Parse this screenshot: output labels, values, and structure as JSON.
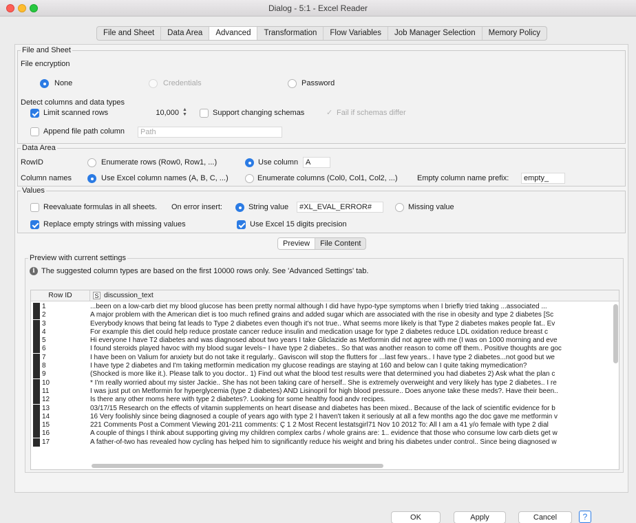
{
  "window": {
    "title": "Dialog - 5:1 - Excel Reader"
  },
  "tabs": [
    "File and Sheet",
    "Data Area",
    "Advanced",
    "Transformation",
    "Flow Variables",
    "Job Manager Selection",
    "Memory Policy"
  ],
  "active_tab": "Advanced",
  "file_and_sheet": {
    "legend": "File and Sheet",
    "encryption_label": "File encryption",
    "enc_none": "None",
    "enc_credentials": "Credentials",
    "enc_password": "Password",
    "detect_label": "Detect columns and data types",
    "limit_rows_label": "Limit scanned rows",
    "limit_rows_value": "10,000",
    "support_schemas_label": "Support changing schemas",
    "fail_schemas_label": "Fail if schemas differ",
    "append_path_label": "Append file path column",
    "path_placeholder": "Path"
  },
  "data_area": {
    "legend": "Data Area",
    "rowid_label": "RowID",
    "enumerate_rows_label": "Enumerate rows (Row0, Row1, ...)",
    "use_column_label": "Use column",
    "use_column_value": "A",
    "column_names_label": "Column names",
    "excel_names_label": "Use Excel column names (A, B, C, ...)",
    "enumerate_cols_label": "Enumerate columns (Col0, Col1, Col2, ...)",
    "prefix_label": "Empty column name prefix:",
    "prefix_value": "empty_"
  },
  "values": {
    "legend": "Values",
    "reevaluate_label": "Reevaluate formulas in all sheets.",
    "on_error_label": "On error insert:",
    "string_value_label": "String value",
    "string_value": "#XL_EVAL_ERROR#",
    "missing_value_label": "Missing value",
    "replace_empty_label": "Replace empty strings with missing values",
    "excel15_label": "Use Excel 15 digits precision"
  },
  "preview_tabs": [
    "Preview",
    "File Content"
  ],
  "preview": {
    "legend": "Preview with current settings",
    "info": "The suggested column types are based on the first 10000 rows only. See 'Advanced Settings' tab.",
    "col_rowid": "Row ID",
    "col_type": "S",
    "col_name": "discussion_text",
    "rows": [
      {
        "id": "1",
        "text": "...been on a low-carb diet my blood glucose has been pretty normal  although I did have hypo-type symptoms when I briefly tried taking ...associated ..."
      },
      {
        "id": "2",
        "text": "A major problem with the American diet is too much refined grains and added sugar  which are associated with the rise in obesity and type 2 diabetes [Sc"
      },
      {
        "id": "3",
        "text": "Everybody knows that being fat leads to Type 2 diabetes even though it's not true.. What seems more likely is that Type 2 diabetes makes people fat.. Ev"
      },
      {
        "id": "4",
        "text": "For example  this diet could help reduce prostate cancer  reduce insulin and medication usage for type 2 diabetes  reduce LDL oxidation  reduce breast c"
      },
      {
        "id": "5",
        "text": "Hi everyone I have T2 diabetes and was diagnosed about two years I take Gliclazide as Metformin did not agree with me (I was on 1000 morning and eve"
      },
      {
        "id": "6",
        "text": "I found steroids played havoc with my blood sugar levels~ I have type 2 diabetes.. So that was another reason to come off them.. Positive thoughts are goc"
      },
      {
        "id": "7",
        "text": "I have been on Valium for anxiety but do not take it regularly.. Gaviscon will stop the flutters for ...last few years.. I have type 2 diabetes...not good but we"
      },
      {
        "id": "8",
        "text": "I have type 2 diabetes and I'm taking metformin medication my glucose readings are staying at 160 and below can I quite taking mymedication?"
      },
      {
        "id": "9",
        "text": "(Shocked is more like it.). Please talk to you doctor.. 1) Find out what the blood test results were that determined you had diabetes  2) Ask what the plan c"
      },
      {
        "id": "10",
        "text": "* I'm really worried about my sister  Jackie.. She has not been taking care of herself.. She is extremely overweight and very likely has type 2 diabetes.. I re"
      },
      {
        "id": "11",
        "text": "I was just put on Metformin for hyperglycemia (type 2 diabetes) AND Lisinopril for high blood pressure.. Does anyone take these meds?. Have their been.."
      },
      {
        "id": "12",
        "text": "Is there any other moms here with type 2 diabetes?. Looking for some healthy food andv recipes."
      },
      {
        "id": "13",
        "text": "03/17/15 Research on the effects of vitamin supplements on heart disease and diabetes has been mixed.. Because of the lack of scientific evidence for b"
      },
      {
        "id": "14",
        "text": "16 Very foolishly since being diagnosed a couple of years ago with type 2 I haven't taken it seriously at all  a few months ago the doc gave me metformin v"
      },
      {
        "id": "15",
        "text": "221 Comments Post a Comment Viewing 201-211 comments: Ç 1 2 Most Recent lestatsgirl71 Nov 10  2012 To: All I am a 41 y/o female with type 2 dial"
      },
      {
        "id": "16",
        "text": "A couple of things I think about supporting giving my children complex carbs / whole grains are: 1.. evidence that those who consume low carb diets get w"
      },
      {
        "id": "17",
        "text": "A father-of-two has revealed how cycling has helped him to significantly reduce his weight and bring his diabetes under control.. Since being diagnosed w"
      }
    ]
  },
  "buttons": {
    "ok": "OK",
    "apply": "Apply",
    "cancel": "Cancel",
    "help": "?"
  }
}
